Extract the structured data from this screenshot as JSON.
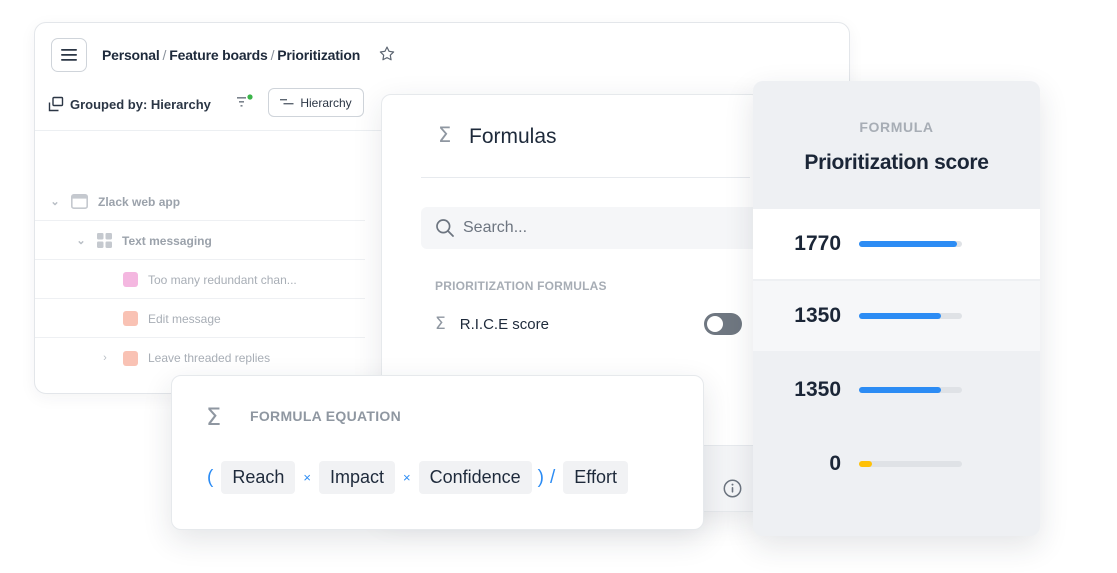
{
  "board": {
    "breadcrumb": [
      "Personal",
      "Feature boards",
      "Prioritization"
    ],
    "breadcrumb_separator": "/",
    "grouped_by": "Grouped by: Hierarchy",
    "hierarchy_button": "Hierarchy",
    "tree": [
      {
        "label": "Zlack web app",
        "color": "#c5c9cf",
        "level": 0,
        "expanded": true
      },
      {
        "label": "Text messaging",
        "color": "#c5c9cf",
        "level": 1,
        "expanded": true
      },
      {
        "label": "Too many redundant chan...",
        "color": "#f4b7e0",
        "level": 2
      },
      {
        "label": "Edit message",
        "color": "#f9c2b4",
        "level": 2
      },
      {
        "label": "Leave threaded replies",
        "color": "#f9c2b4",
        "level": 2,
        "collapsed": true
      }
    ]
  },
  "formulas": {
    "title": "Formulas",
    "search_placeholder": "Search...",
    "section_label": "PRIORITIZATION FORMULAS",
    "items": [
      {
        "label": "R.I.C.E score",
        "enabled": false
      }
    ]
  },
  "score_panel": {
    "kicker": "FORMULA",
    "title": "Prioritization score",
    "rows": [
      {
        "value": "1770",
        "fill": 0.95,
        "color": "#2c8cf4"
      },
      {
        "value": "1350",
        "fill": 0.8,
        "color": "#2c8cf4"
      },
      {
        "value": "1350",
        "fill": 0.8,
        "color": "#2c8cf4"
      },
      {
        "value": "0",
        "fill": 0.13,
        "color": "#ffc107"
      }
    ]
  },
  "equation": {
    "title": "FORMULA EQUATION",
    "open_paren": "(",
    "close_paren": ")",
    "divide": "/",
    "operator": "×",
    "terms": [
      "Reach",
      "Impact",
      "Confidence"
    ],
    "divisor": "Effort"
  },
  "colors": {
    "accent": "#2c8cf4",
    "warning": "#ffc107",
    "notification_dot": "#3bb44a"
  }
}
